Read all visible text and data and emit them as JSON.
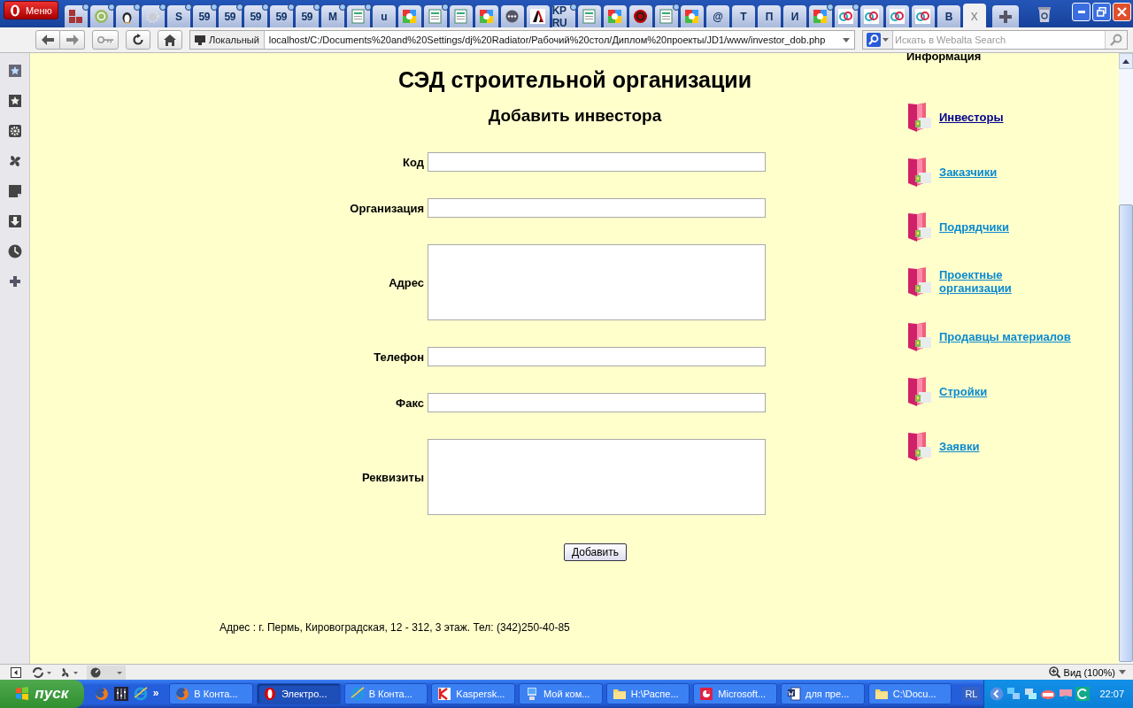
{
  "browser": {
    "menu_button": "Меню",
    "tabs": [
      {
        "kind": "blocks",
        "dot": true,
        "selected": false
      },
      {
        "kind": "globe",
        "dot": true,
        "selected": false
      },
      {
        "kind": "penguin",
        "dot": true,
        "selected": false
      },
      {
        "kind": "gear",
        "dot": true,
        "selected": false
      },
      {
        "kind": "text",
        "label": "S",
        "dot": true,
        "selected": false
      },
      {
        "kind": "text",
        "label": "59",
        "dot": true,
        "selected": false
      },
      {
        "kind": "text",
        "label": "59",
        "dot": true,
        "selected": false
      },
      {
        "kind": "text",
        "label": "59",
        "dot": true,
        "selected": false
      },
      {
        "kind": "text",
        "label": "59",
        "dot": true,
        "selected": false
      },
      {
        "kind": "text",
        "label": "59",
        "dot": true,
        "selected": false
      },
      {
        "kind": "text",
        "label": "M",
        "dot": true,
        "selected": false
      },
      {
        "kind": "doc",
        "dot": true,
        "selected": false
      },
      {
        "kind": "text",
        "label": "u",
        "dot": false,
        "selected": false
      },
      {
        "kind": "google",
        "dot": false,
        "selected": false
      },
      {
        "kind": "doc",
        "dot": true,
        "selected": false
      },
      {
        "kind": "doc",
        "dot": false,
        "selected": false
      },
      {
        "kind": "google",
        "dot": false,
        "selected": false
      },
      {
        "kind": "dots",
        "dot": false,
        "selected": false
      },
      {
        "kind": "adobe",
        "dot": false,
        "selected": false
      },
      {
        "kind": "text",
        "label": "KP RU",
        "dot": true,
        "selected": false
      },
      {
        "kind": "doc",
        "dot": false,
        "selected": false
      },
      {
        "kind": "google",
        "dot": false,
        "selected": false
      },
      {
        "kind": "redcircle",
        "dot": false,
        "selected": false
      },
      {
        "kind": "doc",
        "dot": true,
        "selected": false
      },
      {
        "kind": "google",
        "dot": false,
        "selected": false
      },
      {
        "kind": "text",
        "label": "@",
        "dot": false,
        "selected": false
      },
      {
        "kind": "text",
        "label": "T",
        "dot": false,
        "selected": false
      },
      {
        "kind": "text",
        "label": "П",
        "dot": false,
        "selected": false
      },
      {
        "kind": "text",
        "label": "И",
        "dot": false,
        "selected": false
      },
      {
        "kind": "google",
        "dot": true,
        "selected": false
      },
      {
        "kind": "link",
        "dot": true,
        "selected": false
      },
      {
        "kind": "link",
        "dot": false,
        "selected": false
      },
      {
        "kind": "link",
        "dot": false,
        "selected": false
      },
      {
        "kind": "link",
        "dot": false,
        "selected": false
      },
      {
        "kind": "text",
        "label": "В",
        "dot": false,
        "selected": false
      },
      {
        "kind": "close",
        "label": "x",
        "dot": false,
        "selected": true
      }
    ],
    "security_badge": "Локальный",
    "url": "localhost/C:/Documents%20and%20Settings/dj%20Radiator/Рабочий%20стол/Диплом%20проекты/JD1/www/investor_dob.php",
    "search_placeholder": "Искать в Webalta Search",
    "zoom_label": "Вид (100%)"
  },
  "page": {
    "title": "СЭД строительной организации",
    "subtitle": "Добавить инвестора",
    "fields": [
      {
        "label": "Код",
        "kind": "input"
      },
      {
        "label": "Организация",
        "kind": "input"
      },
      {
        "label": "Адрес",
        "kind": "textarea"
      },
      {
        "label": "Телефон",
        "kind": "input"
      },
      {
        "label": "Факс",
        "kind": "input"
      },
      {
        "label": "Реквизиты",
        "kind": "textarea"
      }
    ],
    "submit": "Добавить",
    "footer": "Адрес : г. Пермь, Кировоградская, 12 - 312, 3 этаж. Тел: (342)250-40-85",
    "sidebar": {
      "heading": "Информация",
      "links": [
        {
          "label": "Инвесторы",
          "visited": true
        },
        {
          "label": "Заказчики",
          "visited": false
        },
        {
          "label": "Подрядчики",
          "visited": false
        },
        {
          "label": "Проектные организации",
          "visited": false
        },
        {
          "label": "Продавцы материалов",
          "visited": false
        },
        {
          "label": "Стройки",
          "visited": false
        },
        {
          "label": "Заявки",
          "visited": false
        }
      ]
    }
  },
  "taskbar": {
    "start": "пуск",
    "more": "»",
    "tasks": [
      {
        "label": "В Конта...",
        "kind": "firefox",
        "selected": false
      },
      {
        "label": "Электро...",
        "kind": "opera",
        "selected": true
      },
      {
        "label": "В Конта...",
        "kind": "ie",
        "selected": false
      },
      {
        "label": "Kaspersk...",
        "kind": "kaspersky",
        "selected": false
      },
      {
        "label": "Мой ком...",
        "kind": "computer",
        "selected": false
      },
      {
        "label": "H:\\Распе...",
        "kind": "folder",
        "selected": false
      },
      {
        "label": "Microsoft...",
        "kind": "powerpoint",
        "selected": false
      },
      {
        "label": "для пре...",
        "kind": "word",
        "selected": false
      },
      {
        "label": "C:\\Docu...",
        "kind": "folder",
        "selected": false
      }
    ],
    "language": "RL",
    "clock": "22:07"
  }
}
